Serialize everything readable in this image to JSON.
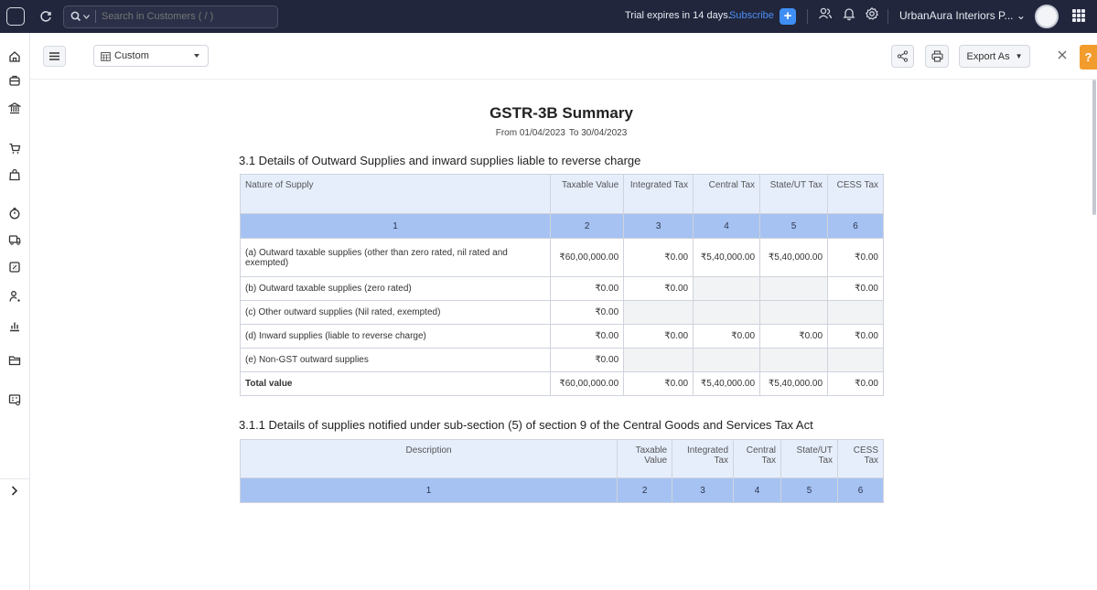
{
  "topbar": {
    "search_placeholder": "Search in Customers ( / )",
    "trial_text": "Trial expires in 14 days.",
    "subscribe_label": "Subscribe",
    "org_name": "UrbanAura Interiors P...",
    "colors": {
      "background": "#21263c",
      "accent": "#3f8ef5"
    }
  },
  "toolbar": {
    "period_label": "Custom",
    "export_label": "Export As",
    "help_label": "?"
  },
  "report": {
    "title": "GSTR-3B Summary",
    "period_from": "From 01/04/2023",
    "period_to": "To 30/04/2023",
    "section1": {
      "title": "3.1 Details of Outward Supplies and inward supplies liable to reverse charge",
      "headers": [
        "Nature of Supply",
        "Taxable Value",
        "Integrated Tax",
        "Central Tax",
        "State/UT Tax",
        "CESS Tax"
      ],
      "column_numbers": [
        "1",
        "2",
        "3",
        "4",
        "5",
        "6"
      ],
      "rows": [
        {
          "nature": "(a) Outward taxable supplies (other than zero rated, nil rated and exempted)",
          "taxable": "₹60,00,000.00",
          "integrated": "₹0.00",
          "central": "₹5,40,000.00",
          "state": "₹5,40,000.00",
          "cess": "₹0.00"
        },
        {
          "nature": "(b) Outward taxable supplies (zero rated)",
          "taxable": "₹0.00",
          "integrated": "₹0.00",
          "central": "",
          "state": "",
          "cess": "₹0.00"
        },
        {
          "nature": "(c) Other outward supplies (Nil rated, exempted)",
          "taxable": "₹0.00",
          "integrated": "",
          "central": "",
          "state": "",
          "cess": ""
        },
        {
          "nature": "(d) Inward supplies (liable to reverse charge)",
          "taxable": "₹0.00",
          "integrated": "₹0.00",
          "central": "₹0.00",
          "state": "₹0.00",
          "cess": "₹0.00"
        },
        {
          "nature": "(e) Non-GST outward supplies",
          "taxable": "₹0.00",
          "integrated": "",
          "central": "",
          "state": "",
          "cess": ""
        }
      ],
      "total": {
        "label": "Total value",
        "taxable": "₹60,00,000.00",
        "integrated": "₹0.00",
        "central": "₹5,40,000.00",
        "state": "₹5,40,000.00",
        "cess": "₹0.00"
      }
    },
    "section2": {
      "title": "3.1.1 Details of supplies notified under sub-section (5) of section 9 of the Central Goods and Services Tax Act",
      "headers": [
        "Description",
        "Taxable Value",
        "Integrated Tax",
        "Central Tax",
        "State/UT Tax",
        "CESS Tax"
      ],
      "column_numbers": [
        "1",
        "2",
        "3",
        "4",
        "5",
        "6"
      ]
    }
  }
}
